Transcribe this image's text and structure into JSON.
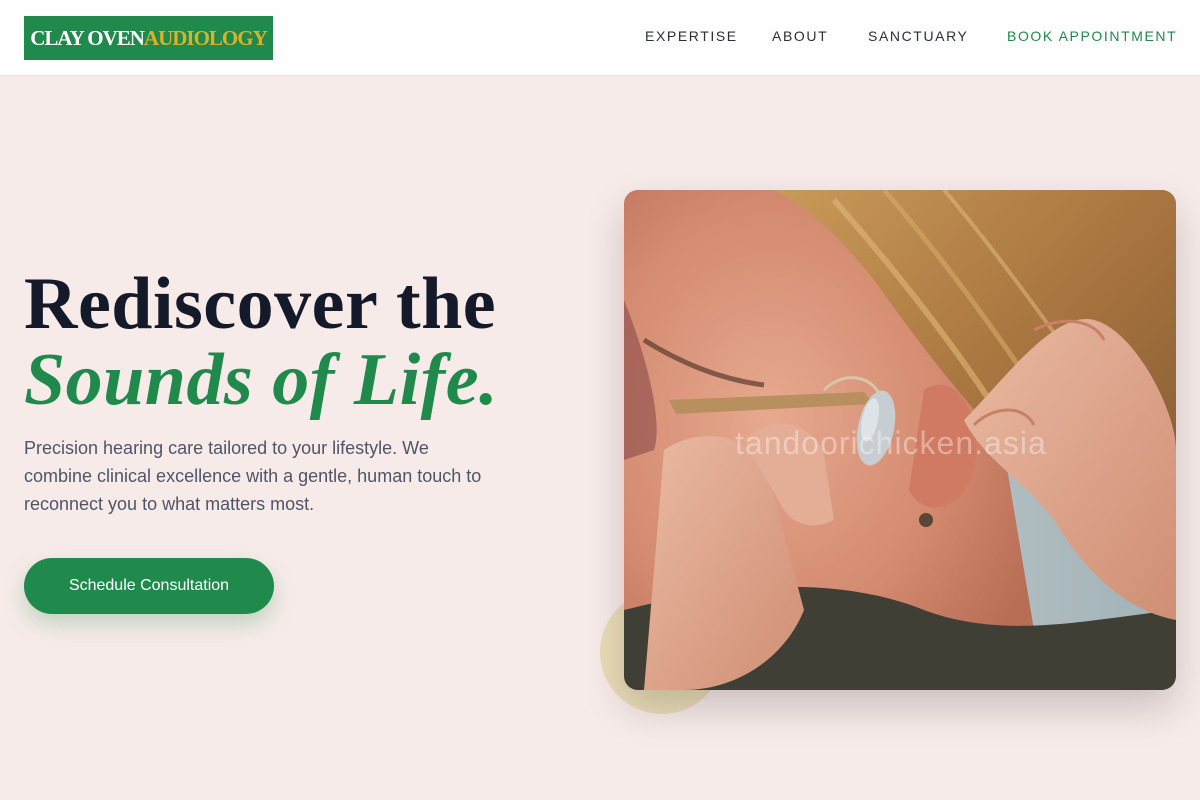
{
  "header": {
    "logo": {
      "part1": "CLAY OVEN",
      "part2": "AUDIOLOGY"
    },
    "nav": [
      {
        "label": "EXPERTISE"
      },
      {
        "label": "ABOUT"
      },
      {
        "label": "SANCTUARY"
      },
      {
        "label": "BOOK APPOINTMENT"
      }
    ]
  },
  "hero": {
    "title_line1": "Rediscover the",
    "title_line2": "Sounds of Life.",
    "description": "Precision hearing care tailored to your lifestyle. We combine clinical excellence with a gentle, human touch to reconnect you to what matters most.",
    "cta_label": "Schedule Consultation",
    "image_watermark": "tandoorichicken.asia"
  },
  "colors": {
    "brand_green": "#1f8a4c",
    "brand_gold": "#d9b227",
    "background": "#f7ebe9",
    "heading": "#141a2a",
    "body_text": "#4f5566",
    "accent_circle": "#eadcb8"
  }
}
